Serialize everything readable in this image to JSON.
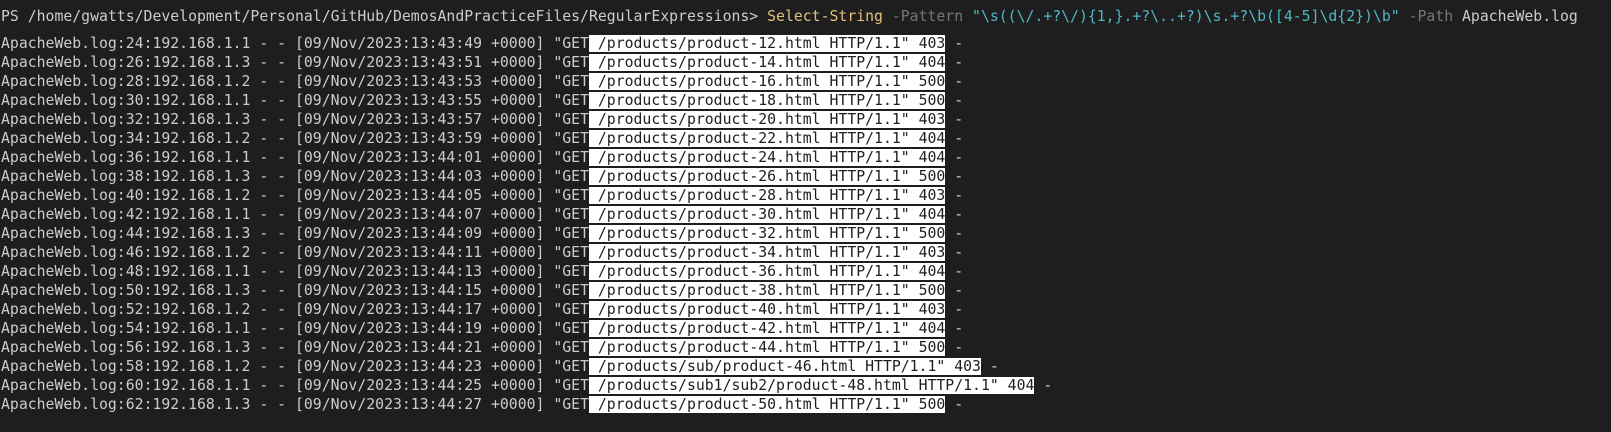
{
  "colors": {
    "background": "#1e1e1e",
    "foreground": "#cccccc",
    "cmdlet": "#e5c07b",
    "parameter": "#767676",
    "string": "#4fb6c6",
    "highlight_bg": "#ffffff",
    "highlight_fg": "#1e1e1e"
  },
  "command": {
    "prompt": "PS /home/gwatts/Development/Personal/GitHub/DemosAndPracticeFiles/RegularExpressions> ",
    "cmdlet": "Select-String",
    "pattern_param": " -Pattern ",
    "pattern_value": "\"\\s((\\/.+?\\/){1,}.+?\\..+?)\\s.+?\\b([4-5]\\d{2})\\b\"",
    "path_param": " -Path ",
    "path_value": "ApacheWeb.log"
  },
  "results": [
    {
      "pre": "ApacheWeb.log:24:192.168.1.1 - - [09/Nov/2023:13:43:49 +0000] \"GET",
      "match": " /products/product-12.html HTTP/1.1\" 403",
      "post": " -"
    },
    {
      "pre": "ApacheWeb.log:26:192.168.1.3 - - [09/Nov/2023:13:43:51 +0000] \"GET",
      "match": " /products/product-14.html HTTP/1.1\" 404",
      "post": " -"
    },
    {
      "pre": "ApacheWeb.log:28:192.168.1.2 - - [09/Nov/2023:13:43:53 +0000] \"GET",
      "match": " /products/product-16.html HTTP/1.1\" 500",
      "post": " -"
    },
    {
      "pre": "ApacheWeb.log:30:192.168.1.1 - - [09/Nov/2023:13:43:55 +0000] \"GET",
      "match": " /products/product-18.html HTTP/1.1\" 500",
      "post": " -"
    },
    {
      "pre": "ApacheWeb.log:32:192.168.1.3 - - [09/Nov/2023:13:43:57 +0000] \"GET",
      "match": " /products/product-20.html HTTP/1.1\" 403",
      "post": " -"
    },
    {
      "pre": "ApacheWeb.log:34:192.168.1.2 - - [09/Nov/2023:13:43:59 +0000] \"GET",
      "match": " /products/product-22.html HTTP/1.1\" 404",
      "post": " -"
    },
    {
      "pre": "ApacheWeb.log:36:192.168.1.1 - - [09/Nov/2023:13:44:01 +0000] \"GET",
      "match": " /products/product-24.html HTTP/1.1\" 404",
      "post": " -"
    },
    {
      "pre": "ApacheWeb.log:38:192.168.1.3 - - [09/Nov/2023:13:44:03 +0000] \"GET",
      "match": " /products/product-26.html HTTP/1.1\" 500",
      "post": " -"
    },
    {
      "pre": "ApacheWeb.log:40:192.168.1.2 - - [09/Nov/2023:13:44:05 +0000] \"GET",
      "match": " /products/product-28.html HTTP/1.1\" 403",
      "post": " -"
    },
    {
      "pre": "ApacheWeb.log:42:192.168.1.1 - - [09/Nov/2023:13:44:07 +0000] \"GET",
      "match": " /products/product-30.html HTTP/1.1\" 404",
      "post": " -"
    },
    {
      "pre": "ApacheWeb.log:44:192.168.1.3 - - [09/Nov/2023:13:44:09 +0000] \"GET",
      "match": " /products/product-32.html HTTP/1.1\" 500",
      "post": " -"
    },
    {
      "pre": "ApacheWeb.log:46:192.168.1.2 - - [09/Nov/2023:13:44:11 +0000] \"GET",
      "match": " /products/product-34.html HTTP/1.1\" 403",
      "post": " -"
    },
    {
      "pre": "ApacheWeb.log:48:192.168.1.1 - - [09/Nov/2023:13:44:13 +0000] \"GET",
      "match": " /products/product-36.html HTTP/1.1\" 404",
      "post": " -"
    },
    {
      "pre": "ApacheWeb.log:50:192.168.1.3 - - [09/Nov/2023:13:44:15 +0000] \"GET",
      "match": " /products/product-38.html HTTP/1.1\" 500",
      "post": " -"
    },
    {
      "pre": "ApacheWeb.log:52:192.168.1.2 - - [09/Nov/2023:13:44:17 +0000] \"GET",
      "match": " /products/product-40.html HTTP/1.1\" 403",
      "post": " -"
    },
    {
      "pre": "ApacheWeb.log:54:192.168.1.1 - - [09/Nov/2023:13:44:19 +0000] \"GET",
      "match": " /products/product-42.html HTTP/1.1\" 404",
      "post": " -"
    },
    {
      "pre": "ApacheWeb.log:56:192.168.1.3 - - [09/Nov/2023:13:44:21 +0000] \"GET",
      "match": " /products/product-44.html HTTP/1.1\" 500",
      "post": " -"
    },
    {
      "pre": "ApacheWeb.log:58:192.168.1.2 - - [09/Nov/2023:13:44:23 +0000] \"GET",
      "match": " /products/sub/product-46.html HTTP/1.1\" 403",
      "post": " -"
    },
    {
      "pre": "ApacheWeb.log:60:192.168.1.1 - - [09/Nov/2023:13:44:25 +0000] \"GET",
      "match": " /products/sub1/sub2/product-48.html HTTP/1.1\" 404",
      "post": " -"
    },
    {
      "pre": "ApacheWeb.log:62:192.168.1.3 - - [09/Nov/2023:13:44:27 +0000] \"GET",
      "match": " /products/product-50.html HTTP/1.1\" 500",
      "post": " -"
    }
  ]
}
